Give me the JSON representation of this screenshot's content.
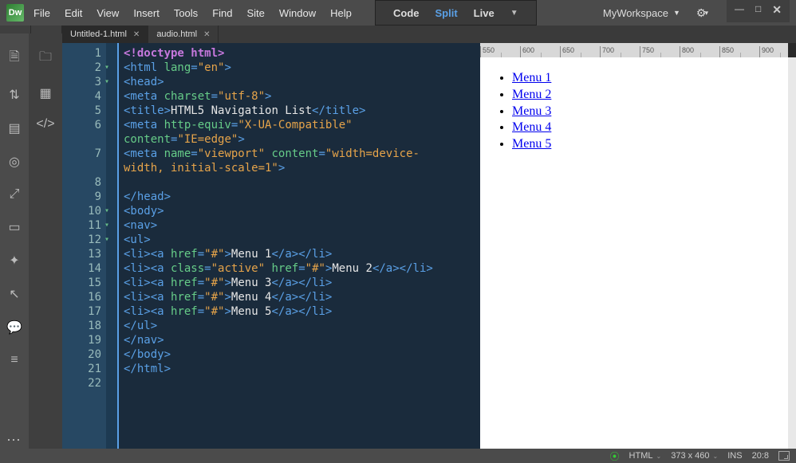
{
  "logo": "Dw",
  "menu": {
    "file": "File",
    "edit": "Edit",
    "view": "View",
    "insert": "Insert",
    "tools": "Tools",
    "find": "Find",
    "site": "Site",
    "window": "Window",
    "help": "Help"
  },
  "viewmode": {
    "code": "Code",
    "split": "Split",
    "live": "Live"
  },
  "workspace": {
    "name": "MyWorkspace"
  },
  "tabs": [
    {
      "label": "Untitled-1.html",
      "active": true
    },
    {
      "label": "audio.html",
      "active": false
    }
  ],
  "ruler": {
    "start": 550,
    "step": 50,
    "count": 9
  },
  "preview_menu": [
    "Menu 1",
    "Menu 2",
    "Menu 3",
    "Menu 4",
    "Menu 5"
  ],
  "code": [
    {
      "n": 1,
      "tri": false,
      "tokens": [
        [
          "doctype",
          "<!doctype html>"
        ]
      ]
    },
    {
      "n": 2,
      "tri": true,
      "tokens": [
        [
          "tag",
          "<html "
        ],
        [
          "attr",
          "lang"
        ],
        [
          "tag",
          "="
        ],
        [
          "str",
          "\"en\""
        ],
        [
          "tag",
          ">"
        ]
      ]
    },
    {
      "n": 3,
      "tri": true,
      "tokens": [
        [
          "tag",
          "<head>"
        ]
      ]
    },
    {
      "n": 4,
      "tri": false,
      "tokens": [
        [
          "tag",
          "<meta "
        ],
        [
          "attr",
          "charset"
        ],
        [
          "tag",
          "="
        ],
        [
          "str",
          "\"utf-8\""
        ],
        [
          "tag",
          ">"
        ]
      ]
    },
    {
      "n": 5,
      "tri": false,
      "tokens": [
        [
          "tag",
          "<title>"
        ],
        [
          "text",
          "HTML5 Navigation List"
        ],
        [
          "tag",
          "</title>"
        ]
      ]
    },
    {
      "n": 6,
      "tri": false,
      "tokens": [
        [
          "tag",
          "<meta "
        ],
        [
          "attr",
          "http-equiv"
        ],
        [
          "tag",
          "="
        ],
        [
          "str",
          "\"X-UA-Compatible\""
        ],
        [
          "tag",
          " "
        ]
      ]
    },
    {
      "n": "",
      "tri": false,
      "tokens": [
        [
          "attr",
          "content"
        ],
        [
          "tag",
          "="
        ],
        [
          "str",
          "\"IE=edge\""
        ],
        [
          "tag",
          ">"
        ]
      ]
    },
    {
      "n": 7,
      "tri": false,
      "tokens": [
        [
          "tag",
          "<meta "
        ],
        [
          "attr",
          "name"
        ],
        [
          "tag",
          "="
        ],
        [
          "str",
          "\"viewport\""
        ],
        [
          "tag",
          " "
        ],
        [
          "attr",
          "content"
        ],
        [
          "tag",
          "="
        ],
        [
          "str",
          "\"width=device-"
        ]
      ]
    },
    {
      "n": "",
      "tri": false,
      "tokens": [
        [
          "str",
          "width, initial-scale=1\""
        ],
        [
          "tag",
          ">"
        ]
      ]
    },
    {
      "n": 8,
      "tri": false,
      "tokens": []
    },
    {
      "n": 9,
      "tri": false,
      "tokens": [
        [
          "tag",
          "</head>"
        ]
      ]
    },
    {
      "n": 10,
      "tri": true,
      "tokens": [
        [
          "tag",
          "<body>"
        ]
      ]
    },
    {
      "n": 11,
      "tri": true,
      "tokens": [
        [
          "tag",
          "<nav>"
        ]
      ]
    },
    {
      "n": 12,
      "tri": true,
      "tokens": [
        [
          "tag",
          "<ul>"
        ]
      ]
    },
    {
      "n": 13,
      "tri": false,
      "tokens": [
        [
          "tag",
          "<li><a "
        ],
        [
          "attr",
          "href"
        ],
        [
          "tag",
          "="
        ],
        [
          "str",
          "\"#\""
        ],
        [
          "tag",
          ">"
        ],
        [
          "text",
          "Menu 1"
        ],
        [
          "tag",
          "</a></li>"
        ]
      ]
    },
    {
      "n": 14,
      "tri": false,
      "tokens": [
        [
          "tag",
          "<li><a "
        ],
        [
          "attr",
          "class"
        ],
        [
          "tag",
          "="
        ],
        [
          "str",
          "\"active\""
        ],
        [
          "tag",
          " "
        ],
        [
          "attr",
          "href"
        ],
        [
          "tag",
          "="
        ],
        [
          "str",
          "\"#\""
        ],
        [
          "tag",
          ">"
        ],
        [
          "text",
          "Menu 2"
        ],
        [
          "tag",
          "</a></li>"
        ]
      ]
    },
    {
      "n": 15,
      "tri": false,
      "tokens": [
        [
          "tag",
          "<li><a "
        ],
        [
          "attr",
          "href"
        ],
        [
          "tag",
          "="
        ],
        [
          "str",
          "\"#\""
        ],
        [
          "tag",
          ">"
        ],
        [
          "text",
          "Menu 3"
        ],
        [
          "tag",
          "</a></li>"
        ]
      ]
    },
    {
      "n": 16,
      "tri": false,
      "tokens": [
        [
          "tag",
          "<li><a "
        ],
        [
          "attr",
          "href"
        ],
        [
          "tag",
          "="
        ],
        [
          "str",
          "\"#\""
        ],
        [
          "tag",
          ">"
        ],
        [
          "text",
          "Menu 4"
        ],
        [
          "tag",
          "</a></li>"
        ]
      ]
    },
    {
      "n": 17,
      "tri": false,
      "tokens": [
        [
          "tag",
          "<li><a "
        ],
        [
          "attr",
          "href"
        ],
        [
          "tag",
          "="
        ],
        [
          "str",
          "\"#\""
        ],
        [
          "tag",
          ">"
        ],
        [
          "text",
          "Menu 5"
        ],
        [
          "tag",
          "</a></li>"
        ]
      ]
    },
    {
      "n": 18,
      "tri": false,
      "tokens": [
        [
          "tag",
          "</ul>"
        ]
      ]
    },
    {
      "n": 19,
      "tri": false,
      "tokens": [
        [
          "tag",
          "</nav>"
        ]
      ]
    },
    {
      "n": 20,
      "tri": false,
      "tokens": [
        [
          "tag",
          "</body>"
        ]
      ]
    },
    {
      "n": 21,
      "tri": false,
      "tokens": [
        [
          "tag",
          "</html>"
        ]
      ]
    },
    {
      "n": 22,
      "tri": false,
      "tokens": []
    }
  ],
  "status": {
    "lang": "HTML",
    "size": "373 x 460",
    "ins": "INS",
    "time": "20:8"
  }
}
